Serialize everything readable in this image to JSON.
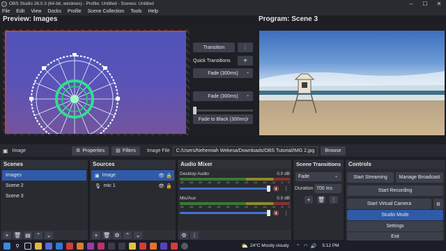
{
  "window": {
    "title": "OBS Studio 28.0.3 (64-bit, windows) - Profile: Untitled - Scenes: Untitled",
    "controls": [
      "–",
      "☐",
      "✕"
    ]
  },
  "menu": [
    "File",
    "Edit",
    "View",
    "Docks",
    "Profile",
    "Scene Collection",
    "Tools",
    "Help"
  ],
  "preview": {
    "title": "Preview: Images"
  },
  "program": {
    "title": "Program: Scene 3"
  },
  "transition": {
    "transition_button": "Transition",
    "quick_label": "Quick Transitions",
    "quick_items": [
      "Fade (300ms)",
      "Fade (300ms)",
      "Fade to Black (300ms)"
    ]
  },
  "source_toolbar": {
    "source_name": "Image",
    "properties": "Properties",
    "filters": "Filters",
    "image_file_label": "Image File",
    "image_path": "C:/Users/Nehemiah Wekesa/Downloads/OBS Tutorial/IMG 2.jpg",
    "browse": "Browse"
  },
  "scenes": {
    "title": "Scenes",
    "items": [
      "Images",
      "Scene 2",
      "Scene 3"
    ]
  },
  "sources": {
    "title": "Sources",
    "items": [
      "Image",
      "mic 1"
    ]
  },
  "mixer": {
    "title": "Audio Mixer",
    "channels": [
      {
        "name": "Desktop Audio",
        "level": "0.0 dB"
      },
      {
        "name": "Mic/Aux",
        "level": "0.0 dB"
      }
    ],
    "ticks": [
      "-60",
      "-55",
      "-50",
      "-45",
      "-40",
      "-35",
      "-30",
      "-25",
      "-20",
      "-15",
      "-10",
      "-5",
      "0"
    ]
  },
  "scene_transitions": {
    "title": "Scene Transitions",
    "type": "Fade",
    "duration_label": "Duration",
    "duration_value": "700 ms"
  },
  "controls": {
    "title": "Controls",
    "start_streaming": "Start Streaming",
    "manage_broadcast": "Manage Broadcast",
    "start_recording": "Start Recording",
    "start_virtual_camera": "Start Virtual Camera",
    "studio_mode": "Studio Mode",
    "settings": "Settings",
    "exit": "Exit"
  },
  "taskbar": {
    "weather": "24°C  Mostly cloudy",
    "time": "5:12 PM",
    "colors": {
      "studio_mode_active": "#2f5aa8"
    }
  }
}
